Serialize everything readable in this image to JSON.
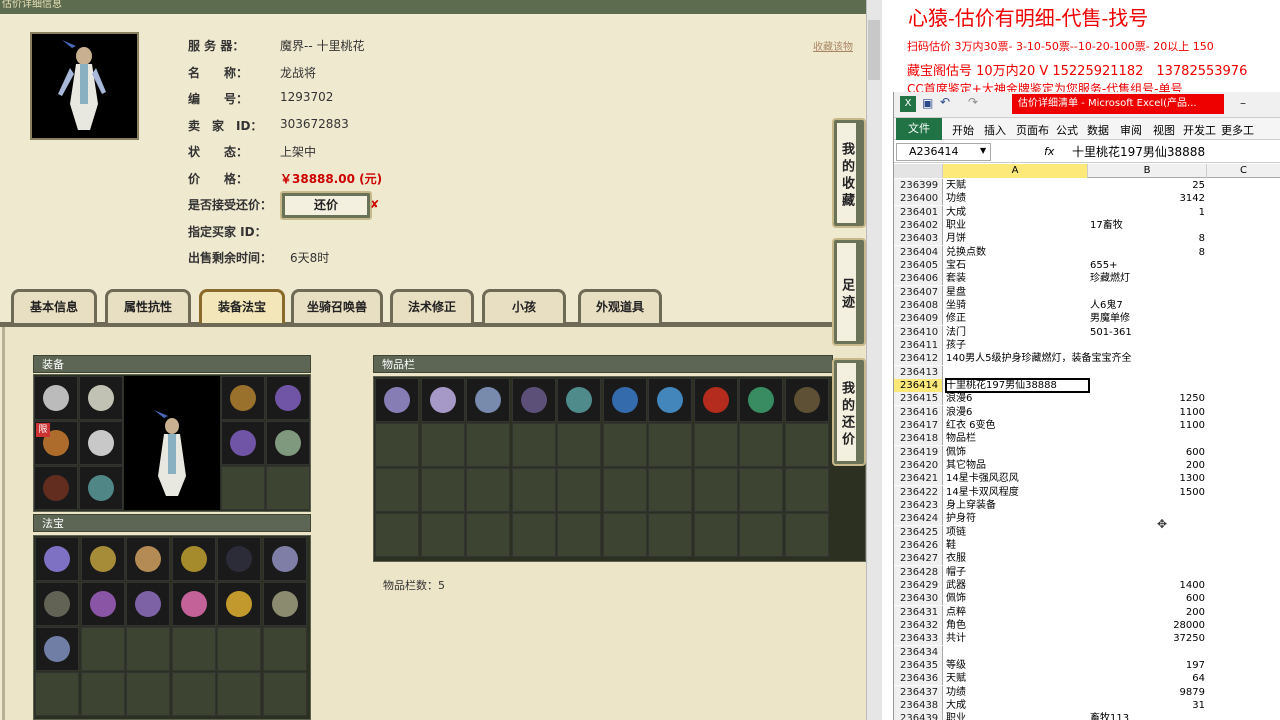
{
  "game": {
    "topbar_label": "估价详细信息",
    "info": [
      {
        "label": "服 务 器：",
        "value": "魔界-- 十里桃花"
      },
      {
        "label": "名　　称：",
        "value": "龙战将"
      },
      {
        "label": "编　　号：",
        "value": "1293702"
      },
      {
        "label": "卖　家　ID：",
        "value": "303672883"
      },
      {
        "label": "状　　态：",
        "value": "上架中"
      },
      {
        "label": "价　　格：",
        "value": "￥38888.00 (元)"
      },
      {
        "label": "是否接受还价：",
        "value": ""
      },
      {
        "label": "指定买家 ID：",
        "value": ""
      },
      {
        "label": "出售剩余时间：",
        "value": "6天8时"
      }
    ],
    "bargain_label": "还价",
    "favorite_link": "收藏该物",
    "tabs": [
      "基本信息",
      "属性抗性",
      "装备法宝",
      "坐骑召唤兽",
      "法术修正",
      "小孩",
      "外观道具"
    ],
    "active_tab": 2,
    "panels": {
      "equip": "装备",
      "treasure": "法宝",
      "inventory": "物品栏"
    },
    "limit_badge": "限",
    "inventory_count": "物品栏数：5",
    "side_buttons": [
      "我的收藏",
      "足迹",
      "我的还价"
    ],
    "item_colors": [
      "#9a8fd0",
      "#c0b0e8",
      "#8aa0c8",
      "#6a5a8a",
      "#5aa0a0",
      "#3a7ac8",
      "#4a9ad8",
      "#d03020",
      "#40a070",
      "#6a5a3a"
    ],
    "equip_colors": [
      "#d8d8d8",
      "#e0e0d0",
      "#c87a30",
      "#e8e8e8",
      "#703020",
      "#5a9a9a",
      "#b08030",
      "#8060c0",
      "#8060c0",
      "#90b090"
    ],
    "treasure_colors": [
      "#9080e0",
      "#c0a040",
      "#d0a060",
      "#c0a030",
      "#303040",
      "#9090c0",
      "#707060",
      "#a060c0",
      "#9070c0",
      "#e070b0",
      "#e0b030",
      "#a0a080",
      "#8090c0"
    ]
  },
  "notes": {
    "line1": "心猿-估价有明细-代售-找号",
    "line2": "扫码估价 3万内30票- 3-10-50票--10-20-100票- 20以上 150",
    "line3": "藏宝阁估号 10万内20 V 15225921182　13782553976",
    "line4": "CC首席鉴定+大神金牌鉴定为您服务-代售组号-单号"
  },
  "excel": {
    "title_red": "估价详细清单 - Microsoft Excel(产品...",
    "file_tab": "文件",
    "ribbon_tabs": [
      "开始",
      "插入",
      "页面布",
      "公式",
      "数据",
      "审阅",
      "视图",
      "开发工",
      "更多工"
    ],
    "name_box": "A236414",
    "fx": "fx",
    "formula_value": "十里桃花197男仙38888",
    "col_headers": [
      "A",
      "B",
      "C"
    ],
    "rows": [
      {
        "n": "236399",
        "a": "天赋",
        "b": "25",
        "num": true
      },
      {
        "n": "236400",
        "a": "功绩",
        "b": "3142",
        "num": true
      },
      {
        "n": "236401",
        "a": "大成",
        "b": "1",
        "num": true
      },
      {
        "n": "236402",
        "a": "职业",
        "b": "17畜牧",
        "num": false
      },
      {
        "n": "236403",
        "a": "月饼",
        "b": "8",
        "num": true
      },
      {
        "n": "236404",
        "a": "兑换点数",
        "b": "8",
        "num": true
      },
      {
        "n": "236405",
        "a": "宝石",
        "b": "655+",
        "num": false
      },
      {
        "n": "236406",
        "a": "套装",
        "b": "珍藏燃灯",
        "num": false
      },
      {
        "n": "236407",
        "a": "星盘",
        "b": "",
        "num": false
      },
      {
        "n": "236408",
        "a": "坐骑",
        "b": "人6鬼7",
        "num": false
      },
      {
        "n": "236409",
        "a": "修正",
        "b": "男魔单修",
        "num": false
      },
      {
        "n": "236410",
        "a": "法门",
        "b": "501-361",
        "num": false
      },
      {
        "n": "236411",
        "a": "孩子",
        "b": "",
        "num": false
      },
      {
        "n": "236412",
        "a": "140男人5级护身珍藏燃灯，装备宝宝齐全",
        "b": "",
        "num": false
      },
      {
        "n": "236413",
        "a": "",
        "b": "",
        "num": false
      },
      {
        "n": "236414",
        "a": "十里桃花197男仙38888",
        "b": "",
        "num": false
      },
      {
        "n": "236415",
        "a": "浪漫6",
        "b": "1250",
        "num": true
      },
      {
        "n": "236416",
        "a": "浪漫6",
        "b": "1100",
        "num": true
      },
      {
        "n": "236417",
        "a": "红衣 6变色",
        "b": "1100",
        "num": true
      },
      {
        "n": "236418",
        "a": "物品栏",
        "b": "",
        "num": false
      },
      {
        "n": "236419",
        "a": "佩饰",
        "b": "600",
        "num": true
      },
      {
        "n": "236420",
        "a": "其它物品",
        "b": "200",
        "num": true
      },
      {
        "n": "236421",
        "a": "14星卡强风忍风",
        "b": "1300",
        "num": true
      },
      {
        "n": "236422",
        "a": "14星卡双风程度",
        "b": "1500",
        "num": true
      },
      {
        "n": "236423",
        "a": "身上穿装备",
        "b": "",
        "num": false
      },
      {
        "n": "236424",
        "a": "护身符",
        "b": "",
        "num": false
      },
      {
        "n": "236425",
        "a": "项链",
        "b": "",
        "num": false
      },
      {
        "n": "236426",
        "a": "鞋",
        "b": "",
        "num": false
      },
      {
        "n": "236427",
        "a": "衣服",
        "b": "",
        "num": false
      },
      {
        "n": "236428",
        "a": "帽子",
        "b": "",
        "num": false
      },
      {
        "n": "236429",
        "a": "武器",
        "b": "1400",
        "num": true
      },
      {
        "n": "236430",
        "a": "佩饰",
        "b": "600",
        "num": true
      },
      {
        "n": "236431",
        "a": "点粹",
        "b": "200",
        "num": true
      },
      {
        "n": "236432",
        "a": "角色",
        "b": "28000",
        "num": true
      },
      {
        "n": "236433",
        "a": "共计",
        "b": "37250",
        "num": true
      },
      {
        "n": "236434",
        "a": "",
        "b": "",
        "num": false
      },
      {
        "n": "236435",
        "a": "等级",
        "b": "197",
        "num": true
      },
      {
        "n": "236436",
        "a": "天赋",
        "b": "64",
        "num": true
      },
      {
        "n": "236437",
        "a": "功绩",
        "b": "9879",
        "num": true
      },
      {
        "n": "236438",
        "a": "大成",
        "b": "31",
        "num": true
      },
      {
        "n": "236439",
        "a": "职业",
        "b": "畜牧113",
        "num": false
      }
    ],
    "selected_row": "236414"
  }
}
